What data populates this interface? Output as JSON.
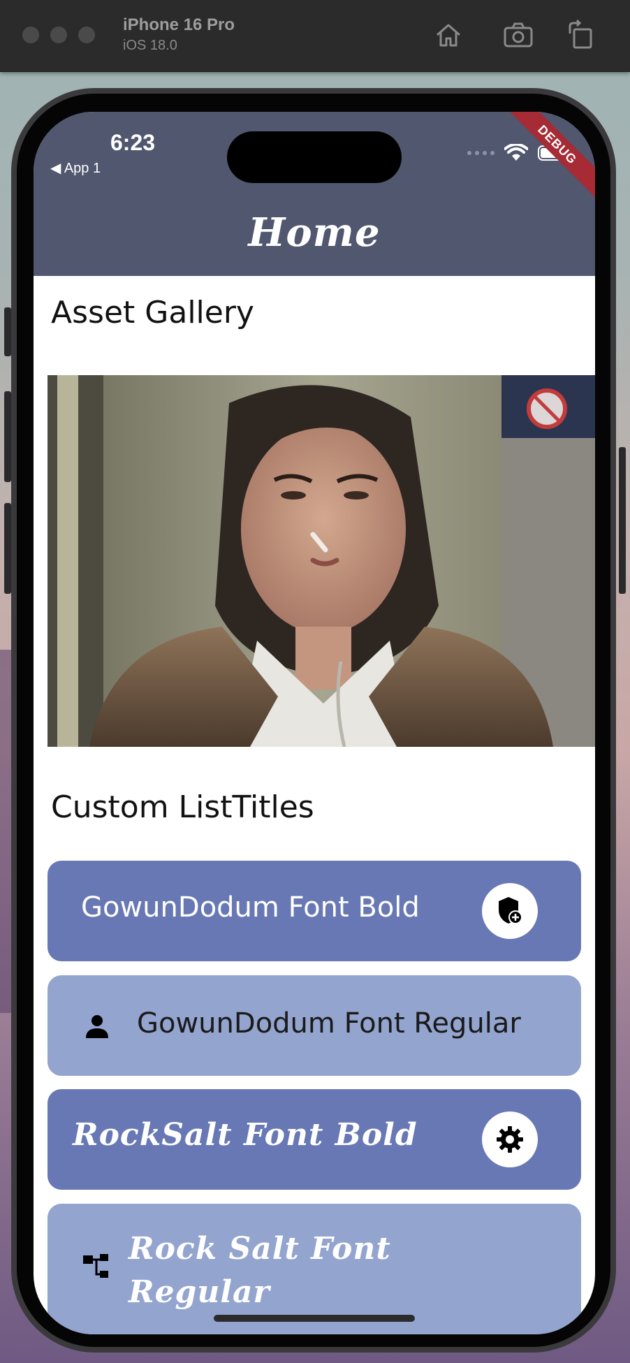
{
  "simulator": {
    "device_name": "iPhone 16 Pro",
    "os_version": "iOS 18.0",
    "icons": [
      "home-icon",
      "screenshot-icon",
      "rotate-icon"
    ]
  },
  "status_bar": {
    "time": "6:23",
    "back_label": "◀ App 1",
    "debug_banner": "DEBUG"
  },
  "app_bar": {
    "title": "Home"
  },
  "sections": {
    "gallery_title": "Asset Gallery",
    "list_title": "Custom ListTitles"
  },
  "list_tiles": [
    {
      "label": "GowunDodum Font Bold",
      "trailing_icon": "shield-add-icon"
    },
    {
      "label": "GowunDodum Font Regular",
      "leading_icon": "person-icon"
    },
    {
      "label": "RockSalt Font Bold",
      "trailing_icon": "gear-icon"
    },
    {
      "label": "Rock Salt Font Regular",
      "leading_icon": "account-tree-icon"
    }
  ],
  "colors": {
    "app_bar": "#50576f",
    "tile_dark": "#6878b4",
    "tile_light": "#93a4cf",
    "debug": "#a62b35"
  }
}
